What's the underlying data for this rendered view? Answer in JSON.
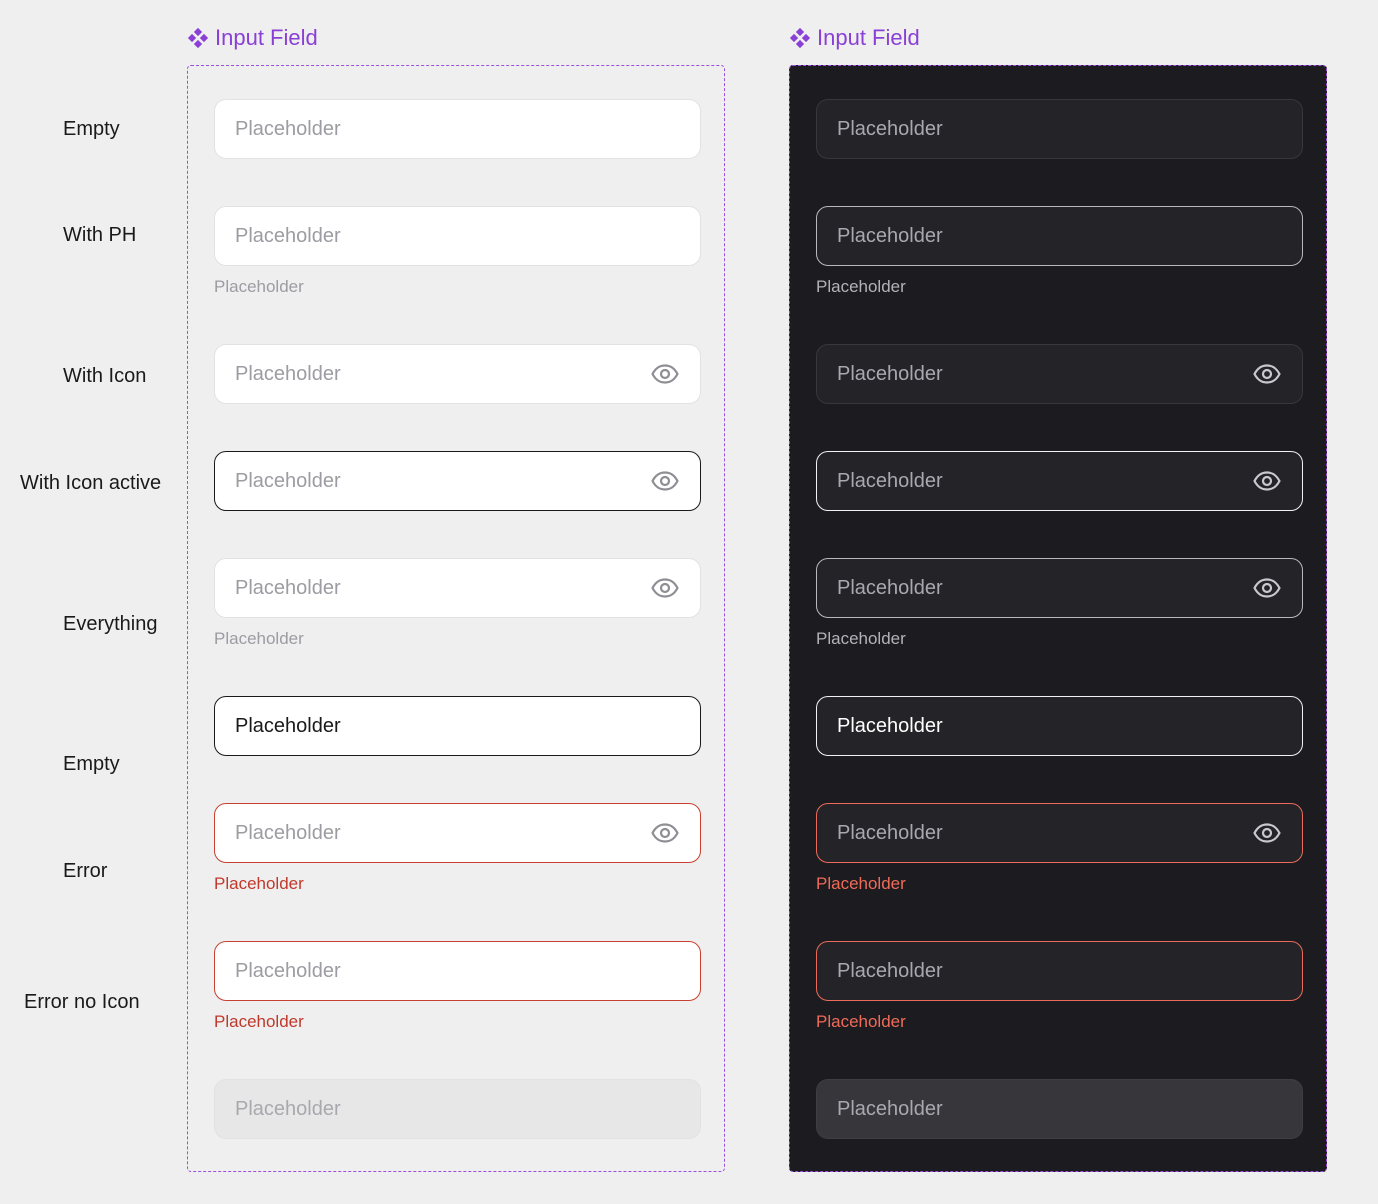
{
  "row_labels": [
    "Empty",
    "With PH",
    "With Icon",
    "With Icon active",
    "Everything",
    "Empty",
    "Error",
    "Error no Icon"
  ],
  "frames": [
    {
      "title": "Input Field"
    },
    {
      "title": "Input Field"
    }
  ],
  "field_text": "Placeholder",
  "helper_text": "Placeholder",
  "colors": {
    "accent": "#8a3fd6",
    "error_light": "#c0392b",
    "error_dark": "#ef6b58",
    "dark_bg": "#1c1b1f"
  },
  "icons": {
    "frame_title": "component-diamond-icon",
    "field_trailing": "eye-icon"
  }
}
